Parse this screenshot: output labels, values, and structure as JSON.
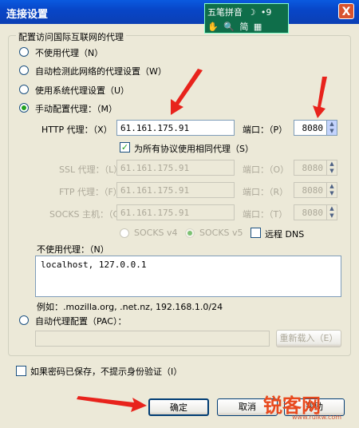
{
  "window": {
    "title": "连接设置",
    "close_label": "X"
  },
  "ime": {
    "mode": "五笔拼音",
    "moon": "☽",
    "dots": "•9",
    "hand": "✋",
    "search": "🔍",
    "simplified": "简",
    "grid": "▦"
  },
  "group_title": "配置访问国际互联网的代理",
  "options": {
    "no_proxy": "不使用代理（N）",
    "auto_detect": "自动检测此网络的代理设置（W）",
    "system": "使用系统代理设置（U）",
    "manual": "手动配置代理：（M）"
  },
  "http": {
    "label": "HTTP 代理：（X）",
    "value": "61.161.175.91",
    "port_label": "端口：（P）",
    "port": "8080"
  },
  "same_proxy_label": "为所有协议使用相同代理（S）",
  "ssl": {
    "label": "SSL 代理：（L）",
    "value": "61.161.175.91",
    "port_label": "端口：（O）",
    "port": "8080"
  },
  "ftp": {
    "label": "FTP 代理：（F）",
    "value": "61.161.175.91",
    "port_label": "端口：（R）",
    "port": "8080"
  },
  "socks": {
    "label": "SOCKS 主机：（C）",
    "value": "61.161.175.91",
    "port_label": "端口：（T）",
    "port": "8080"
  },
  "socks_v4": "SOCKS v4",
  "socks_v5": "SOCKS v5",
  "remote_dns": "远程 DNS",
  "no_proxy_for": {
    "label": "不使用代理：（N）",
    "value": "localhost, 127.0.0.1"
  },
  "example": "例如：.mozilla.org, .net.nz, 192.168.1.0/24",
  "pac": {
    "label": "自动代理配置（PAC）：",
    "value": "",
    "reload": "重新载入（E）"
  },
  "no_auth_prompt": "如果密码已保存，不提示身份验证（I）",
  "buttons": {
    "ok": "确定",
    "cancel": "取消",
    "help": "帮助"
  },
  "watermark": {
    "text": "锐客网",
    "url": "www.ruikw.com"
  },
  "colors": {
    "titlebar": "#0846c8",
    "face": "#ece9d8",
    "arrow": "#e8231c",
    "check": "#21a121"
  }
}
